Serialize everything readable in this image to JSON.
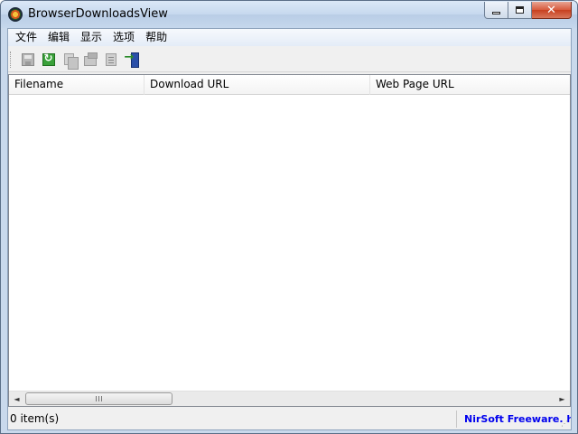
{
  "window": {
    "title": "BrowserDownloadsView",
    "icon": "app-icon"
  },
  "menubar": {
    "items": [
      {
        "label": "文件"
      },
      {
        "label": "编辑"
      },
      {
        "label": "显示"
      },
      {
        "label": "选项"
      },
      {
        "label": "帮助"
      }
    ]
  },
  "toolbar": {
    "buttons": [
      {
        "icon": "save-icon"
      },
      {
        "icon": "refresh-icon"
      },
      {
        "icon": "copy-icon"
      },
      {
        "icon": "properties-icon"
      },
      {
        "icon": "html-report-icon"
      },
      {
        "icon": "exit-icon"
      }
    ]
  },
  "list": {
    "columns": [
      "Filename",
      "Download URL",
      "Web Page URL"
    ],
    "rows": []
  },
  "scrollbar": {
    "left_arrow": "◄",
    "right_arrow": "►"
  },
  "status": {
    "count": "0 item(s)",
    "link": "NirSoft Freeware. htt"
  }
}
